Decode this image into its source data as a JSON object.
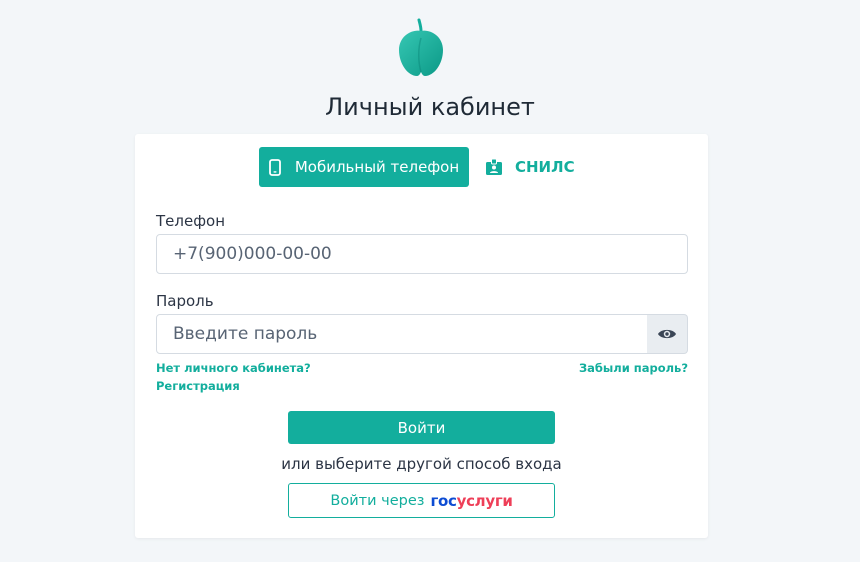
{
  "header": {
    "title": "Личный кабинет"
  },
  "tabs": {
    "mobile_label": "Мобильный телефон",
    "snils_label": "СНИЛС"
  },
  "form": {
    "phone_label": "Телефон",
    "phone_placeholder": "+7(900)000-00-00",
    "password_label": "Пароль",
    "password_placeholder": "Введите пароль",
    "no_account_link": "Нет личного кабинета?",
    "register_link": "Регистрация",
    "forgot_link": "Забыли пароль?",
    "login_button": "Войти",
    "alt_text": "или выберите другой способ входа",
    "gosuslugi_prefix": "Войти через",
    "gosuslugi_part1": "гос",
    "gosuslugi_part2": "услуги"
  },
  "colors": {
    "accent": "#13ae9d",
    "background": "#f3f6f9",
    "gos_blue": "#0d4cd3",
    "gos_red": "#ee3f58"
  },
  "icons": {
    "logo": "quince-fruit-logo",
    "mobile": "phone-icon",
    "snils": "id-badge-icon",
    "password_toggle": "eye-icon"
  }
}
